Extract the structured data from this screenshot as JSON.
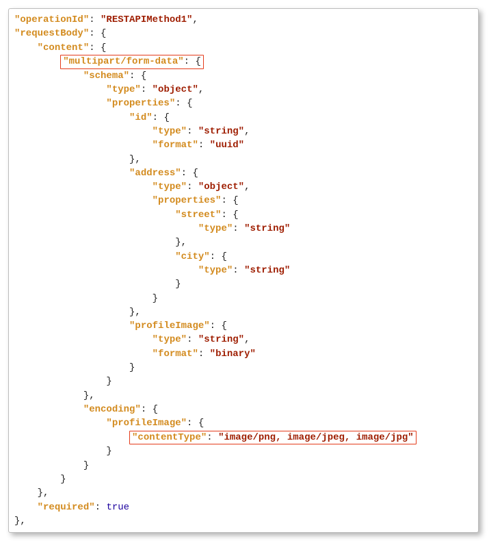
{
  "code": {
    "operationId_key": "\"operationId\"",
    "operationId_val": "\"RESTAPIMethod1\"",
    "requestBody_key": "\"requestBody\"",
    "content_key": "\"content\"",
    "multipart_key": "\"multipart/form-data\"",
    "schema_key": "\"schema\"",
    "type_key": "\"type\"",
    "type_object": "\"object\"",
    "properties_key": "\"properties\"",
    "id_key": "\"id\"",
    "type_string": "\"string\"",
    "format_key": "\"format\"",
    "format_uuid": "\"uuid\"",
    "address_key": "\"address\"",
    "street_key": "\"street\"",
    "city_key": "\"city\"",
    "profileImage_key": "\"profileImage\"",
    "format_binary": "\"binary\"",
    "encoding_key": "\"encoding\"",
    "contentType_key": "\"contentType\"",
    "contentType_val": "\"image/png, image/jpeg, image/jpg\"",
    "required_key": "\"required\"",
    "required_val": "true",
    "colon": ": ",
    "open": "{",
    "close": "}",
    "close_comma": "},",
    "comma": ","
  }
}
